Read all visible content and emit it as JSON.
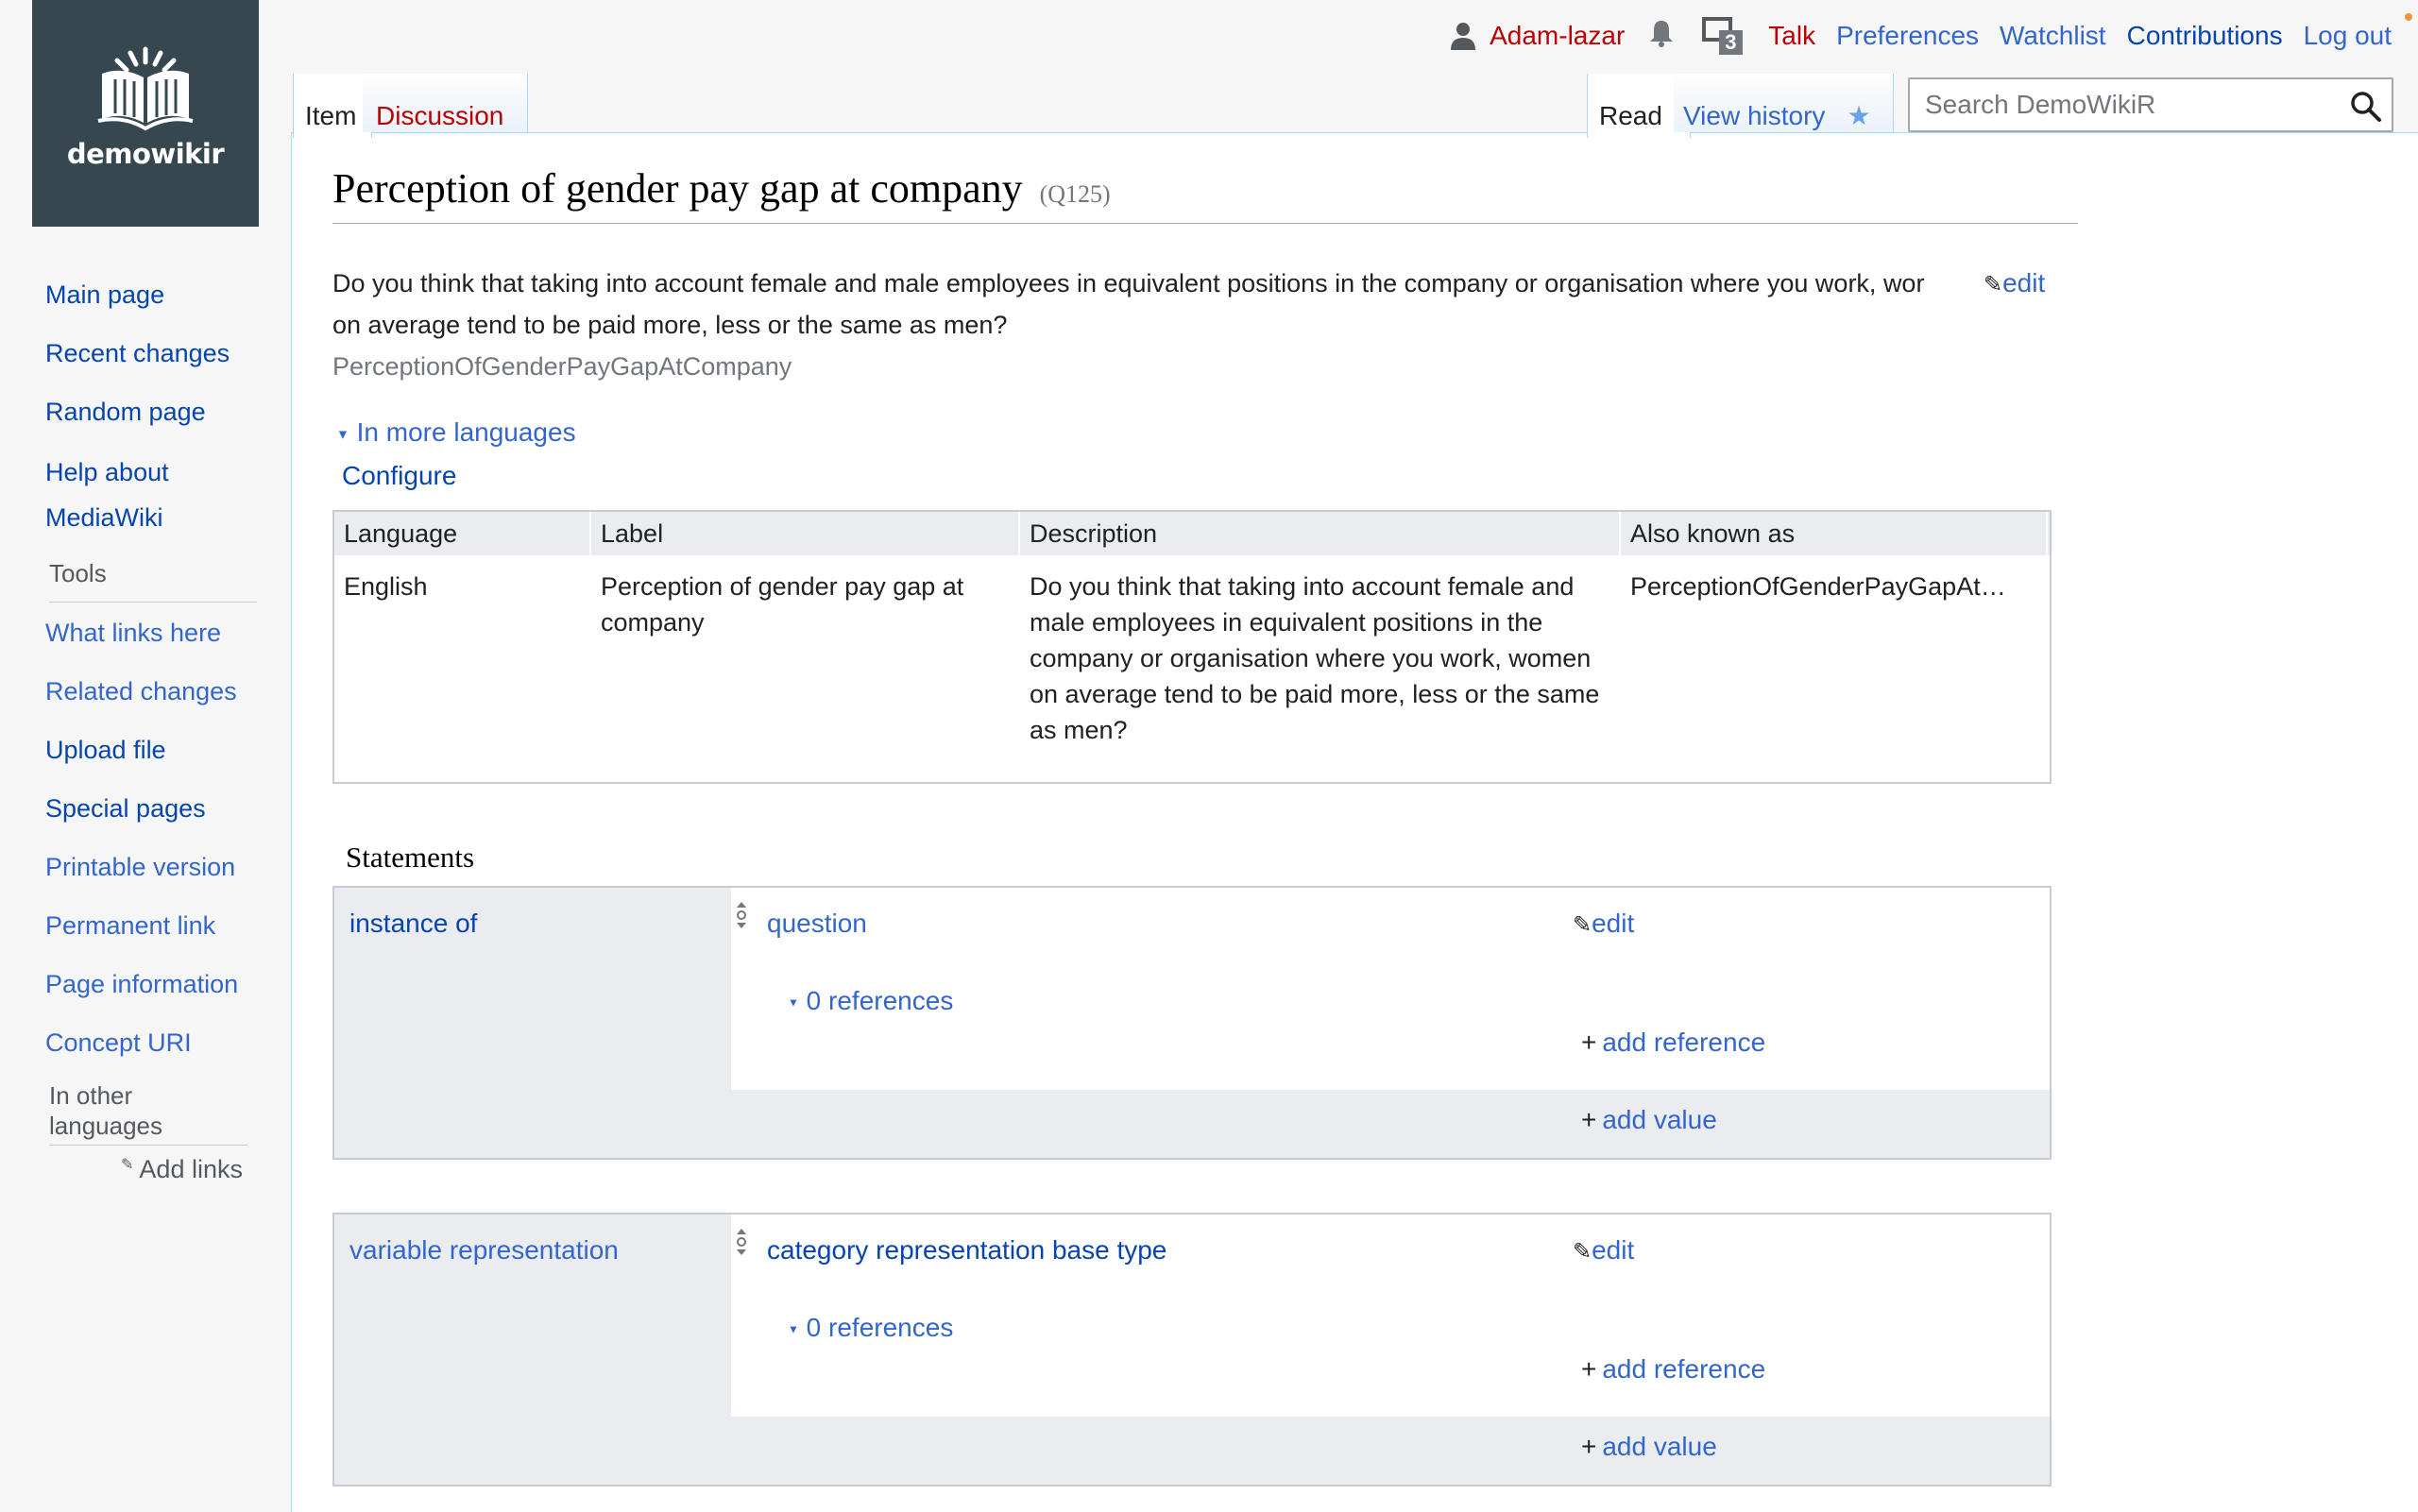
{
  "site": {
    "logo_text": "demowikir"
  },
  "sidebar": {
    "nav": [
      "Main page",
      "Recent changes",
      "Random page",
      "Help about MediaWiki"
    ],
    "tools_heading": "Tools",
    "tools": [
      "What links here",
      "Related changes",
      "Upload file",
      "Special pages",
      "Printable version",
      "Permanent link",
      "Page information",
      "Concept URI"
    ],
    "languages_heading": "In other languages",
    "add_links": "Add links"
  },
  "personal": {
    "user": "Adam-lazar",
    "notice_count": "3",
    "links": [
      "Talk",
      "Preferences",
      "Watchlist",
      "Contributions",
      "Log out"
    ]
  },
  "tabs": {
    "item": "Item",
    "discussion": "Discussion",
    "read": "Read",
    "history": "View history",
    "star": "★"
  },
  "search": {
    "placeholder": "Search DemoWikiR"
  },
  "page": {
    "title": "Perception of gender pay gap at company",
    "qid": "(Q125)",
    "description": "Do you think that taking into account female and male employees in equivalent positions in the company or organisation where you work, wor on average tend to be paid more, less or the same as men?",
    "description_line1": "Do you think that taking into account female and male employees in equivalent positions in the company or organisation where you work, wor",
    "description_line2": "on average tend to be paid more, less or the same as men?",
    "edit": "edit",
    "alias": "PerceptionOfGenderPayGapAtCompany"
  },
  "languages": {
    "toggle": "In more languages",
    "configure": "Configure",
    "headers": [
      "Language",
      "Label",
      "Description",
      "Also known as"
    ],
    "row": {
      "language": "English",
      "label": "Perception of gender pay gap at company",
      "description": "Do you think that taking into account female and male employees in equivalent positions in the company or organisation where you work, women on average tend to be paid more, less or the same as men?",
      "aliases": "PerceptionOfGenderPayGapAt…"
    }
  },
  "statements": {
    "title": "Statements",
    "items": [
      {
        "property": "instance of",
        "value": "question",
        "edit": "edit",
        "refs": "0 references",
        "add_reference": "add reference",
        "add_value": "add value"
      },
      {
        "property": "variable representation",
        "value": "category representation base type",
        "edit": "edit",
        "refs": "0 references",
        "add_reference": "add reference",
        "add_value": "add value"
      }
    ]
  }
}
